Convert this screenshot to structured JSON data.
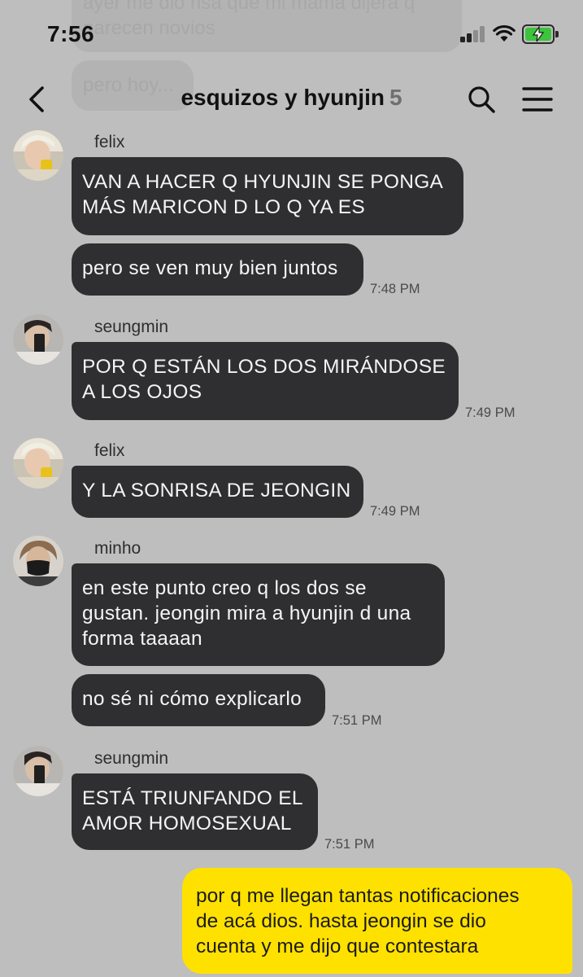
{
  "status_bar": {
    "time": "7:56",
    "icons": [
      "cellular-signal-icon",
      "wifi-icon",
      "battery-charging-icon"
    ],
    "battery_color": "#3cc43c"
  },
  "header": {
    "title": "esquizos y hyunjin",
    "member_count": "5",
    "icons": [
      "back-chevron-icon",
      "search-icon",
      "hamburger-menu-icon"
    ]
  },
  "previous_messages": [
    "ayer me dio risa que mi mamá dijera q parecen novios",
    "pero hoy..."
  ],
  "messages": [
    {
      "sender": "felix",
      "avatar": "felix-avatar",
      "bubbles": [
        "VAN A HACER Q HYUNJIN SE PONGA\nMÁS MARICON D LO Q YA ES",
        "pero se ven muy bien juntos"
      ],
      "time": "7:48 PM"
    },
    {
      "sender": "seungmin",
      "avatar": "seungmin-avatar",
      "bubbles": [
        "POR Q ESTÁN LOS DOS MIRÁNDOSE\nA LOS OJOS"
      ],
      "time": "7:49 PM"
    },
    {
      "sender": "felix",
      "avatar": "felix-avatar",
      "bubbles": [
        "Y LA SONRISA DE JEONGIN"
      ],
      "time": "7:49 PM"
    },
    {
      "sender": "minho",
      "avatar": "minho-avatar",
      "bubbles": [
        "en este punto creo q los dos se\ngustan. jeongin mira a hyunjin d una\nforma taaaan",
        "no sé ni cómo explicarlo"
      ],
      "time": "7:51 PM"
    },
    {
      "sender": "seungmin",
      "avatar": "seungmin-avatar",
      "bubbles": [
        "ESTÁ TRIUNFANDO EL\nAMOR HOMOSEXUAL"
      ],
      "time": "7:51 PM"
    }
  ],
  "my_message": {
    "text": "por q me llegan tantas notificaciones\nde acá dios. hasta jeongin se dio\ncuenta y me dijo que contestara",
    "bubble_color": "#ffe100"
  },
  "colors": {
    "background": "#bebebe",
    "incoming_bubble": "#2f2f31",
    "incoming_text": "#f4f4f4"
  }
}
